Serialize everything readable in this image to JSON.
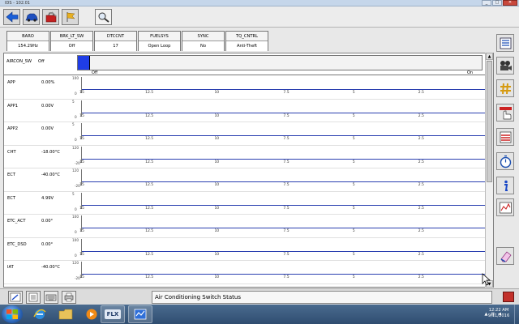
{
  "window": {
    "title": "IDS - 102.01"
  },
  "pids": [
    {
      "name": "BARO",
      "value": "154.29Hz"
    },
    {
      "name": "BRK_LT_SW",
      "value": "Off"
    },
    {
      "name": "DTCCNT",
      "value": "17"
    },
    {
      "name": "FUELSYS",
      "value": "Open Loop"
    },
    {
      "name": "SYNC",
      "value": "No"
    },
    {
      "name": "TQ_CNTRL",
      "value": "Anti-Theft"
    }
  ],
  "aircon": {
    "name": "AIRCON_SW",
    "value": "Off",
    "off_label": "Off",
    "on_label": "On",
    "level": 0.03
  },
  "x_ticks": [
    "15",
    "12.5",
    "10",
    "7.5",
    "5",
    "2.5",
    "0"
  ],
  "rows": [
    {
      "name": "APP",
      "value": "0.00%",
      "ymax": "100",
      "ymin": "0"
    },
    {
      "name": "APP1",
      "value": "0.00V",
      "ymax": "5",
      "ymin": "0"
    },
    {
      "name": "APP2",
      "value": "0.00V",
      "ymax": "5",
      "ymin": "0"
    },
    {
      "name": "CHT",
      "value": "-18.00°C",
      "ymax": "120",
      "ymin": "-20"
    },
    {
      "name": "ECT",
      "value": "-40.00°C",
      "ymax": "120",
      "ymin": "-20"
    },
    {
      "name": "ECT",
      "value": "4.99V",
      "ymax": "5",
      "ymin": "0"
    },
    {
      "name": "ETC_ACT",
      "value": "0.00°",
      "ymax": "100",
      "ymin": "0"
    },
    {
      "name": "ETC_DSD",
      "value": "0.00°",
      "ymax": "100",
      "ymin": "0"
    },
    {
      "name": "IAT",
      "value": "-40.00°C",
      "ymax": "120",
      "ymin": "-20"
    }
  ],
  "status": {
    "text": "Air Conditioning Switch Status"
  },
  "clock": {
    "time": "12:22 AM",
    "date": "9/11/2016"
  },
  "taskbar": {
    "flx_label": "FLX"
  },
  "colors": {
    "accent": "#1f3de6",
    "graph_line": "#2a3fb0",
    "status_flag": "#c2302a"
  }
}
